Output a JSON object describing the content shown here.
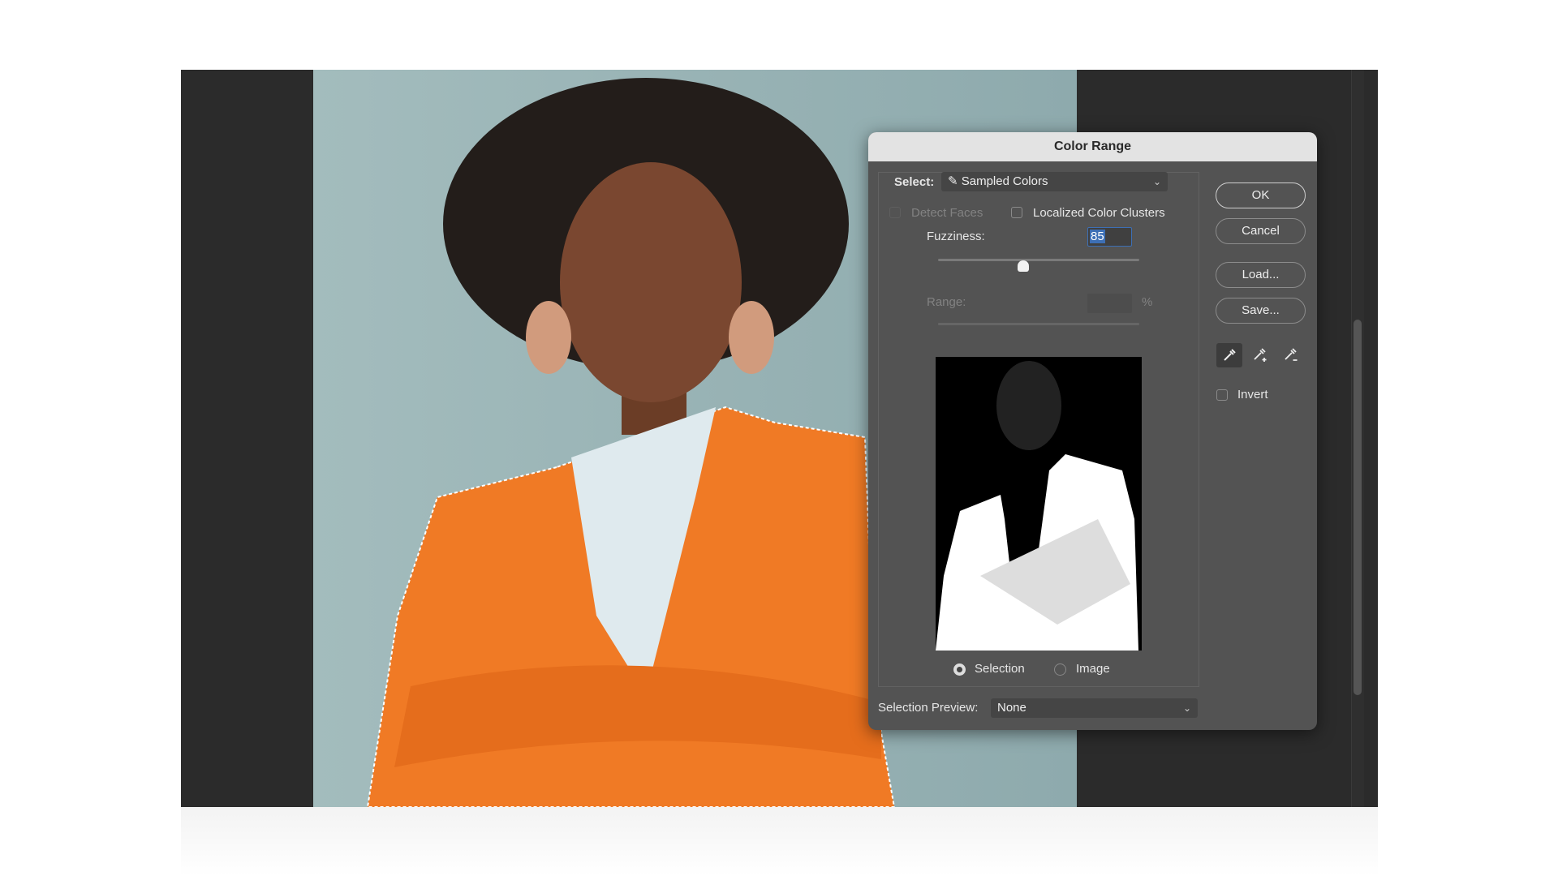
{
  "dialog": {
    "title": "Color Range",
    "select_label": "Select:",
    "select_value": "Sampled Colors",
    "detect_faces": {
      "label": "Detect Faces",
      "checked": false,
      "enabled": false
    },
    "localized_clusters": {
      "label": "Localized Color Clusters",
      "checked": false
    },
    "fuzziness_label": "Fuzziness:",
    "fuzziness_value": "85",
    "fuzziness_slider_fraction": 0.43,
    "range_label": "Range:",
    "range_value": "",
    "range_unit": "%",
    "preview_mode": {
      "selection_label": "Selection",
      "image_label": "Image",
      "selected": "Selection"
    },
    "selection_preview_label": "Selection Preview:",
    "selection_preview_value": "None",
    "buttons": {
      "ok": "OK",
      "cancel": "Cancel",
      "load": "Load...",
      "save": "Save..."
    },
    "eyedroppers": [
      "eyedropper-icon",
      "eyedropper-plus-icon",
      "eyedropper-minus-icon"
    ],
    "active_eyedropper": "eyedropper-icon",
    "invert": {
      "label": "Invert",
      "checked": false
    }
  },
  "colors": {
    "dialog_bg": "#535353",
    "selection_highlight": "#3d6fb5",
    "jacket": "#f07a25"
  }
}
